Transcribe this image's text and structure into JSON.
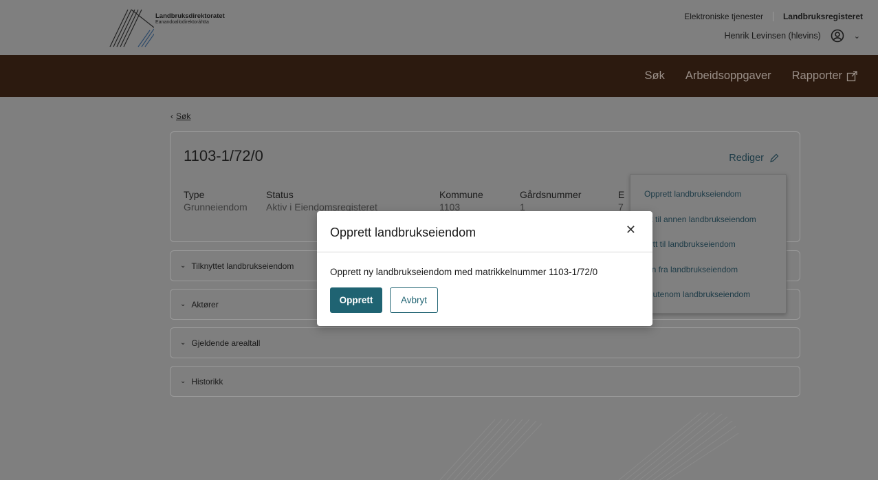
{
  "header": {
    "logo_name": "Landbruksdirektoratet",
    "logo_subname": "Eanandoallodirektoráhtta",
    "util_links": [
      "Elektroniske tjenester",
      "Landbruksregisteret"
    ],
    "user_name": "Henrik Levinsen (hlevins)"
  },
  "nav": {
    "items": [
      "Søk",
      "Arbeidsoppgaver",
      "Rapporter"
    ]
  },
  "breadcrumb": {
    "back_label": "Søk"
  },
  "property": {
    "title": "1103-1/72/0",
    "edit_label": "Rediger",
    "fields": [
      {
        "label": "Type",
        "value": "Grunneiendom"
      },
      {
        "label": "Status",
        "value": "Aktiv i Eiendomsregisteret"
      },
      {
        "label": "Kommune",
        "value": "1103"
      },
      {
        "label": "Gårdsnummer",
        "value": "1"
      },
      {
        "label": "E",
        "value": "7"
      }
    ]
  },
  "sections": [
    "Tilknyttet landbrukseiendom",
    "Aktører",
    "Gjeldende arealtall",
    "Historikk"
  ],
  "menu": {
    "items": [
      "Opprett landbrukseiendom",
      "ytt til annen landbrukseiendom",
      "nytt til landbrukseiendom",
      "ern fra landbrukseiendom",
      "ift utenom landbrukseiendom"
    ]
  },
  "modal": {
    "title": "Opprett landbrukseiendom",
    "message": "Opprett ny landbrukseiendom med matrikkelnummer 1103-1/72/0",
    "confirm_label": "Opprett",
    "cancel_label": "Avbryt"
  }
}
